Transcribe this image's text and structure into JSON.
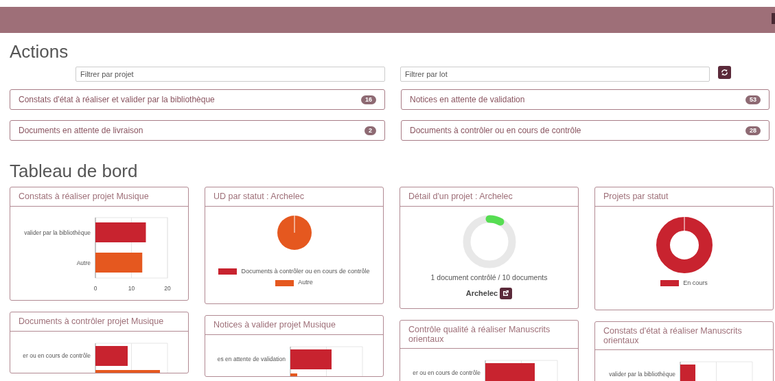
{
  "actions": {
    "title": "Actions",
    "filters": [
      {
        "placeholder": "Filtrer par projet"
      },
      {
        "placeholder": "Filtrer par lot"
      }
    ],
    "items": [
      {
        "label": "Constats d'état à réaliser et valider par la bibliothèque",
        "count": "16"
      },
      {
        "label": "Notices en attente de validation",
        "count": "53"
      },
      {
        "label": "Documents en attente de livraison",
        "count": "2"
      },
      {
        "label": "Documents à contrôler ou en cours de contrôle",
        "count": "28"
      }
    ]
  },
  "dashboard": {
    "title": "Tableau de bord",
    "widgets": [
      {
        "kind": "bar",
        "title": "Constats à réaliser projet Musique",
        "chart_data": {
          "type": "bar",
          "orientation": "horizontal",
          "series": [
            {
              "name": "valider par la bibliothèque",
              "color": "#c8232f",
              "values": [
                14,
                null
              ]
            },
            {
              "name": "Autre",
              "color": "#e5581f",
              "values": [
                null,
                13
              ]
            }
          ],
          "xlim": [
            0,
            20
          ],
          "xticks": [
            0,
            10,
            20
          ]
        }
      },
      {
        "kind": "barpicture",
        "title": "Documents à contrôler projet Musique",
        "bar_labels": [
          "er ou en cours de contrôle"
        ]
      },
      {
        "kind": "pie",
        "title": "UD par statut : Archelec",
        "legend": [
          {
            "label": "Documents à contrôler ou en cours de contrôle",
            "color": "#c8232f"
          },
          {
            "label": "Autre",
            "color": "#e5581f"
          }
        ]
      },
      {
        "kind": "barpicture",
        "title": "Notices à valider projet Musique",
        "bar_labels": [
          "es en attente de validation"
        ]
      },
      {
        "kind": "progress",
        "title": "Détail d'un projet : Archelec",
        "level": 0.1,
        "caption": "1 document contrôlé /  10 documents",
        "project": "Archelec"
      },
      {
        "kind": "barpicture",
        "title": "Contrôle qualité à réaliser Manuscrits orientaux",
        "bar_labels": [
          "er ou en cours de contrôle"
        ]
      },
      {
        "kind": "donut",
        "title": "Projets par statut",
        "legend": [
          {
            "label": "En cours",
            "color": "#c8232f"
          }
        ]
      },
      {
        "kind": "barpicture",
        "title": "Constats d'état à réaliser Manuscrits orientaux",
        "bar_labels": [
          "valider par la bibliothèque"
        ]
      }
    ]
  }
}
